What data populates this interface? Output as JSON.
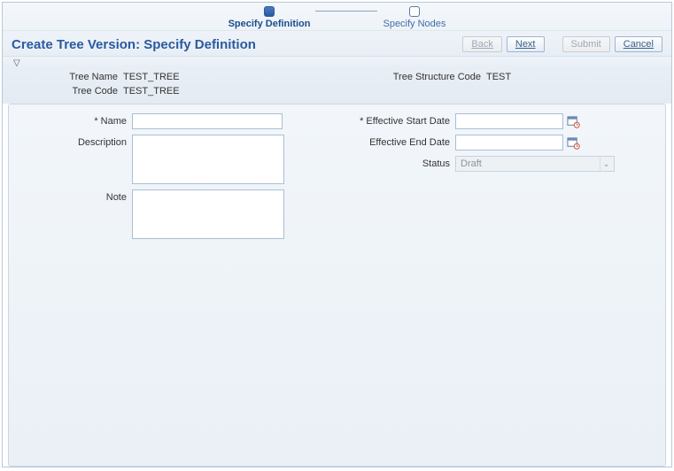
{
  "train": {
    "step1": "Specify Definition",
    "step2": "Specify Nodes"
  },
  "header": {
    "title": "Create Tree Version: Specify Definition",
    "back": "Back",
    "next": "Next",
    "submit": "Submit",
    "cancel": "Cancel"
  },
  "info": {
    "tree_name_label": "Tree Name",
    "tree_name_value": "TEST_TREE",
    "tree_code_label": "Tree Code",
    "tree_code_value": "TEST_TREE",
    "tree_structure_label": "Tree Structure Code",
    "tree_structure_value": "TEST"
  },
  "form": {
    "name_label": "Name",
    "name_value": "",
    "description_label": "Description",
    "description_value": "",
    "note_label": "Note",
    "note_value": "",
    "eff_start_label": "Effective Start Date",
    "eff_start_value": "",
    "eff_end_label": "Effective End Date",
    "eff_end_value": "",
    "status_label": "Status",
    "status_value": "Draft"
  }
}
